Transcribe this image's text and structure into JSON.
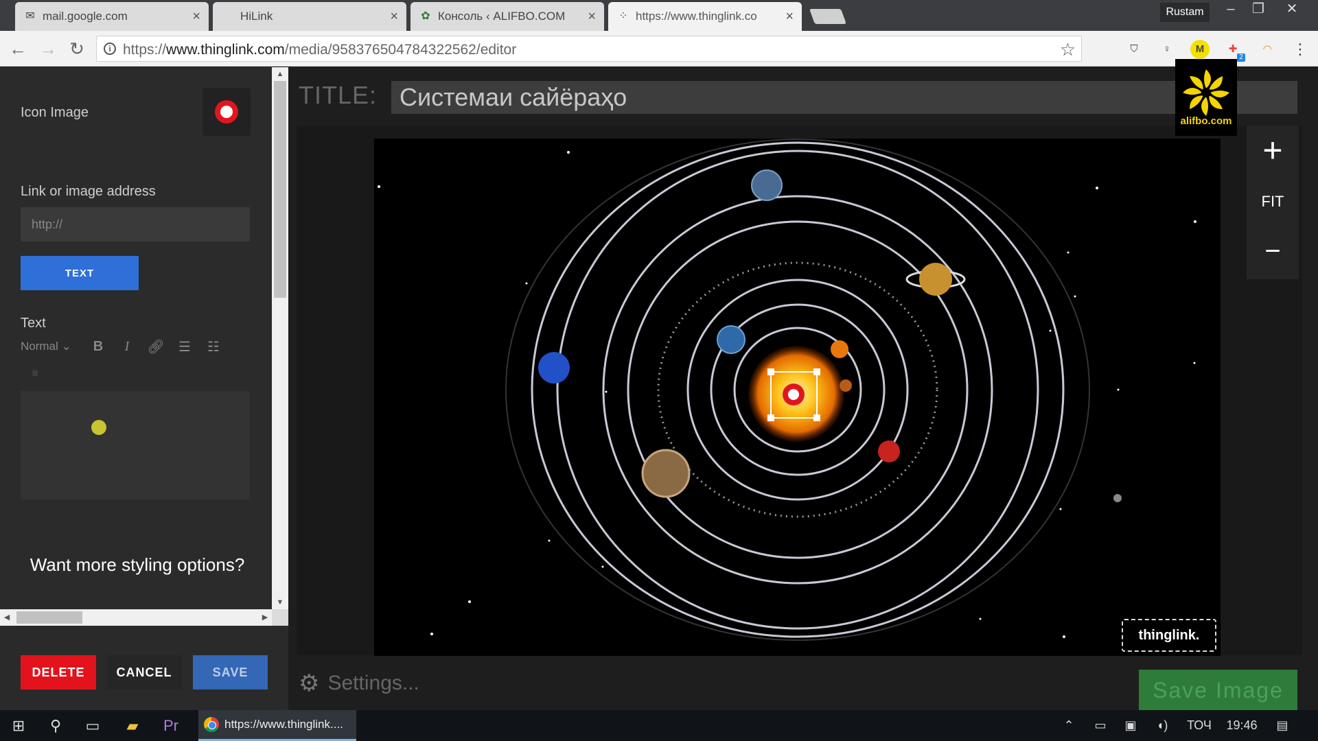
{
  "browser": {
    "tabs": [
      {
        "title": "mail.google.com",
        "icon": "gmail-icon"
      },
      {
        "title": "HiLink",
        "icon": "none"
      },
      {
        "title": "Консоль ‹ ALIFBO.COM",
        "icon": "wordpress-icon"
      },
      {
        "title": "https://www.thinglink.co",
        "icon": "thinglink-icon"
      }
    ],
    "user": "Rustam",
    "url_prefix": "https://",
    "url_host": "www.thinglink.com",
    "url_path": "/media/958376504784322562/editor",
    "extension_badge": "2"
  },
  "sidebar": {
    "icon_image_label": "Icon Image",
    "link_label": "Link or image address",
    "link_placeholder": "http://",
    "text_button": "TEXT",
    "text_label": "Text",
    "format_select": "Normal",
    "styling_question": "Want more styling options?",
    "delete_button": "DELETE",
    "cancel_button": "CANCEL",
    "save_button": "SAVE"
  },
  "editor": {
    "title_label": "TITLE:",
    "title_value": "Системаи сайёраҳо",
    "zoom_in": "+",
    "zoom_fit": "FIT",
    "zoom_out": "−",
    "watermark_logo_text": "alifbo.com",
    "thinglink_badge": "thinglink.",
    "settings_label": "Settings...",
    "save_image_button": "Save Image"
  },
  "taskbar": {
    "active_app": "https://www.thinglink....",
    "language": "ТОЧ",
    "time": "19:46"
  },
  "colors": {
    "accent_blue": "#2e6fd8",
    "delete_red": "#e3131d",
    "save_green": "#2f7c3a",
    "hotspot_red": "#e0161f",
    "logo_yellow": "#f5d400"
  }
}
